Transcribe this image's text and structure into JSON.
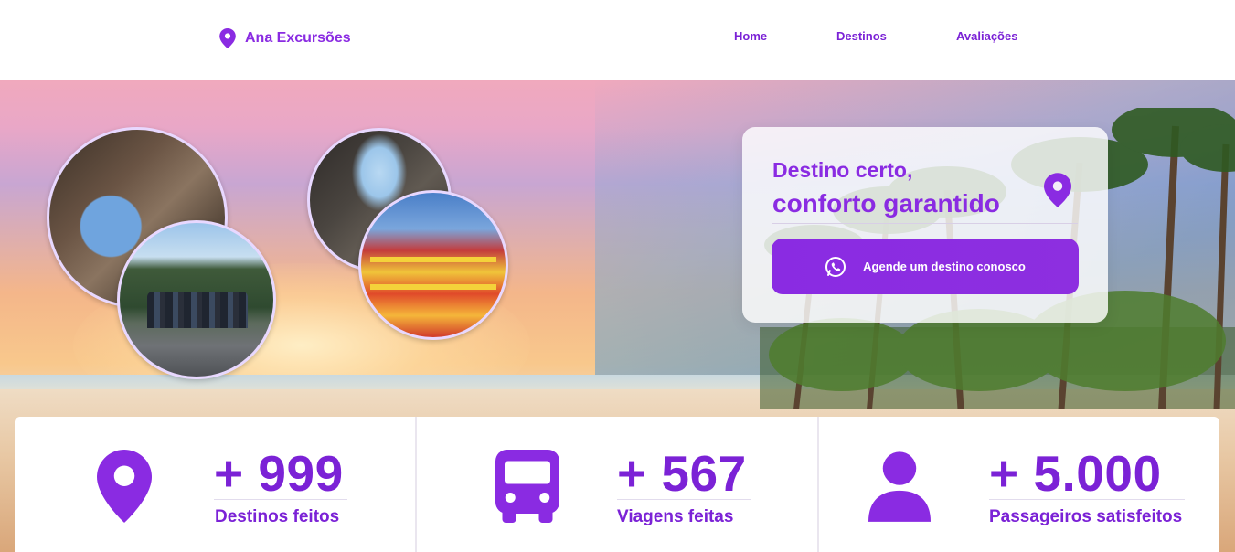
{
  "header": {
    "brand_name": "Ana Excursões",
    "brand_icon": "map-pin-icon",
    "nav": [
      {
        "label": "Home"
      },
      {
        "label": "Destinos"
      },
      {
        "label": "Avaliações"
      }
    ]
  },
  "hero": {
    "card": {
      "line1": "Destino certo,",
      "line2": "conforto garantido",
      "icon": "map-pin-icon",
      "cta_label": "Agende um destino conosco",
      "cta_icon": "whatsapp-icon"
    }
  },
  "stats": [
    {
      "icon": "map-pin-icon",
      "value": "+ 999",
      "label": "Destinos feitos"
    },
    {
      "icon": "bus-icon",
      "value": "+ 567",
      "label": "Viagens feitas"
    },
    {
      "icon": "user-icon",
      "value": "+ 5.000",
      "label": "Passageiros satisfeitos"
    }
  ],
  "colors": {
    "accent": "#8a2be2",
    "accent_dark": "#7b22d6",
    "background": "#ffffff"
  }
}
